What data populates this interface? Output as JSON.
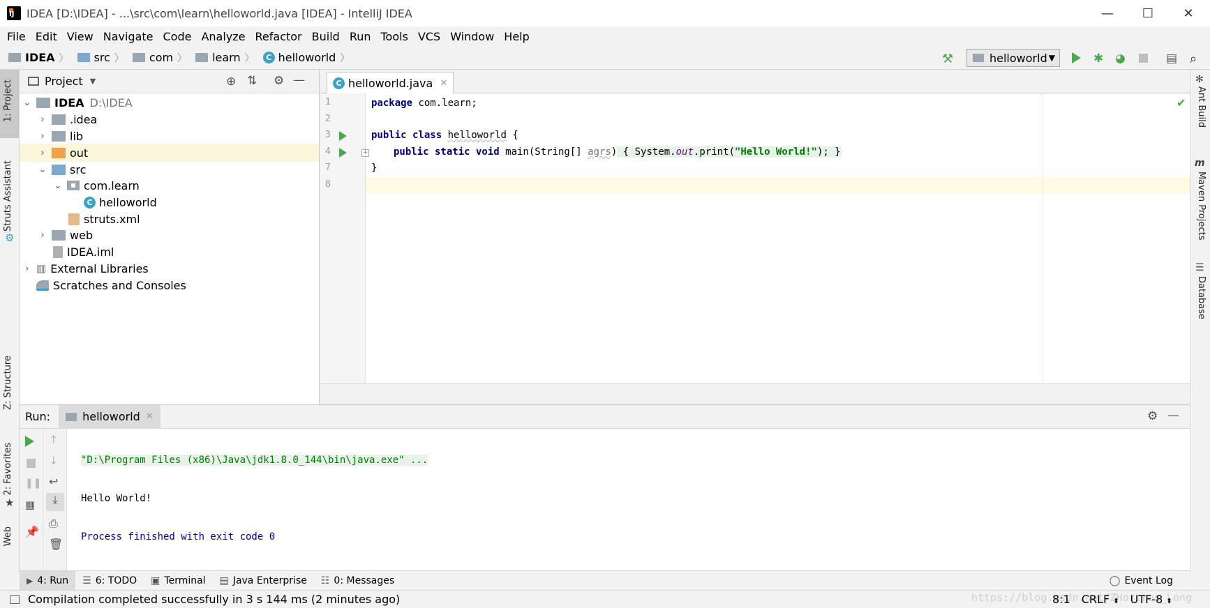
{
  "window": {
    "title": "IDEA [D:\\IDEA] - ...\\src\\com\\learn\\helloworld.java [IDEA] - IntelliJ IDEA"
  },
  "menu": [
    "File",
    "Edit",
    "View",
    "Navigate",
    "Code",
    "Analyze",
    "Refactor",
    "Build",
    "Run",
    "Tools",
    "VCS",
    "Window",
    "Help"
  ],
  "breadcrumb": [
    "IDEA",
    "src",
    "com",
    "learn",
    "helloworld"
  ],
  "run_config": "helloworld",
  "left_tools": {
    "project": "1: Project",
    "struts": "Struts Assistant",
    "structure": "Z: Structure",
    "favorites": "2: Favorites",
    "web": "Web"
  },
  "right_tools": {
    "ant": "Ant Build",
    "maven": "Maven Projects",
    "database": "Database"
  },
  "project": {
    "header": "Project",
    "root_name": "IDEA",
    "root_path": "D:\\IDEA",
    "items": [
      ".idea",
      "lib",
      "out",
      "src",
      "com.learn",
      "helloworld",
      "struts.xml",
      "web",
      "IDEA.iml",
      "External Libraries",
      "Scratches and Consoles"
    ]
  },
  "editor": {
    "tab": "helloworld.java",
    "line_numbers": [
      "1",
      "2",
      "3",
      "4",
      "7",
      "8"
    ],
    "code": {
      "l1_kw": "package",
      "l1_rest": " com.learn;",
      "l3_kw": "public class",
      "l3_cls": "helloworld",
      "l3_rest": " {",
      "l4_kw": "public static void",
      "l4_a": " main(String[] ",
      "l4_param": "agrs",
      ")": ")",
      "l4_b": " { System.",
      "l4_fld": "out",
      "l4_c": ".print(",
      "l4_str": "\"Hello World!\"",
      "l4_d": "); }",
      "l7": "}"
    }
  },
  "run": {
    "label": "Run:",
    "tab": "helloworld",
    "console": [
      "\"D:\\Program Files (x86)\\Java\\jdk1.8.0_144\\bin\\java.exe\" ...",
      "Hello World!",
      "Process finished with exit code 0"
    ]
  },
  "bottom_tabs": [
    "4: Run",
    "6: TODO",
    "Terminal",
    "Java Enterprise",
    "0: Messages"
  ],
  "event_log": "Event Log",
  "status": {
    "message": "Compilation completed successfully in 3 s 144 ms (2 minutes ago)",
    "position": "8:1",
    "line_sep": "CRLF",
    "encoding": "UTF-8"
  },
  "watermark": "https://blog.csdn.net/ZHorcrux_Long",
  "colors": {
    "run_green": "#4ba84f",
    "keyword": "#000080",
    "string": "#008000",
    "field": "#660e7a",
    "console_blue": "#0000aa"
  }
}
